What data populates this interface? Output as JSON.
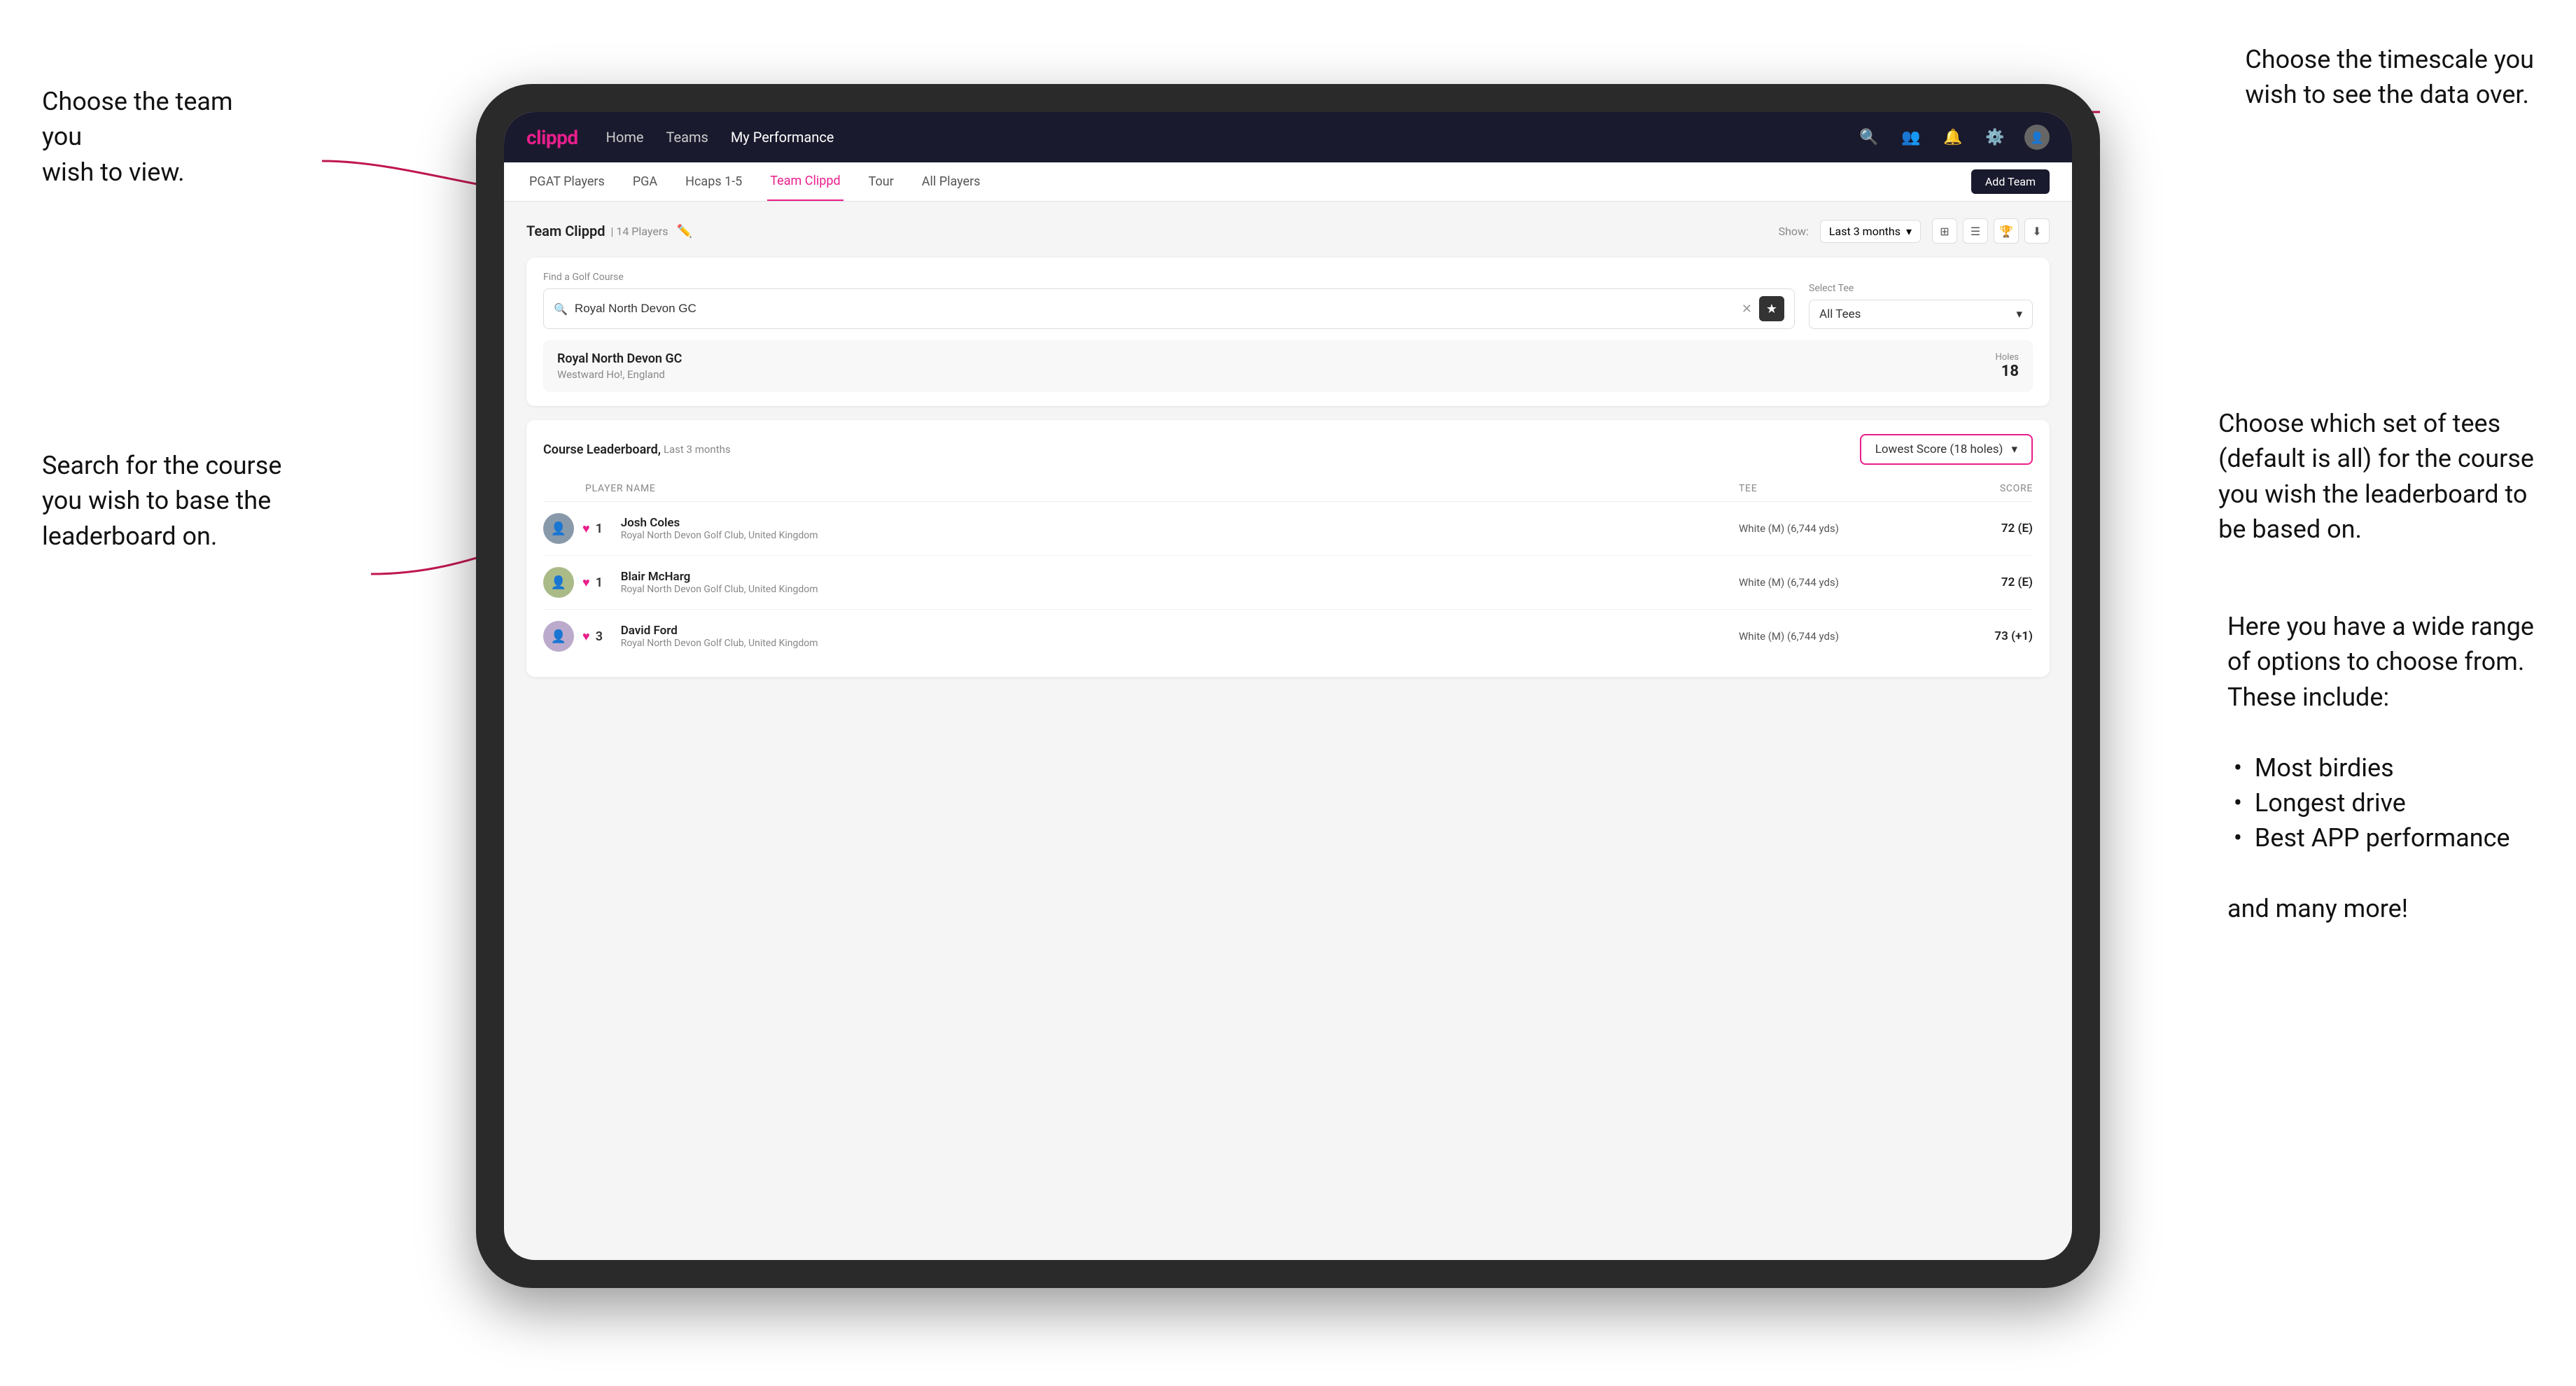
{
  "annotations": {
    "top_left": {
      "line1": "Choose the team you",
      "line2": "wish to view."
    },
    "middle_left": {
      "line1": "Search for the course",
      "line2": "you wish to base the",
      "line3": "leaderboard on."
    },
    "top_right": {
      "line1": "Choose the timescale you",
      "line2": "wish to see the data over."
    },
    "middle_right": {
      "line1": "Choose which set of tees",
      "line2": "(default is all) for the course",
      "line3": "you wish the leaderboard to",
      "line4": "be based on."
    },
    "bottom_right": {
      "intro": "Here you have a wide range",
      "intro2": "of options to choose from.",
      "intro3": "These include:",
      "bullets": [
        "Most birdies",
        "Longest drive",
        "Best APP performance"
      ],
      "outro": "and many more!"
    }
  },
  "nav": {
    "logo": "clippd",
    "links": [
      "Home",
      "Teams",
      "My Performance"
    ],
    "active_link": "My Performance"
  },
  "sub_nav": {
    "items": [
      "PGAT Players",
      "PGA",
      "Hcaps 1-5",
      "Team Clippd",
      "Tour",
      "All Players"
    ],
    "active_item": "Team Clippd",
    "add_team_label": "Add Team"
  },
  "team_header": {
    "name": "Team Clippd",
    "count": "14 Players",
    "show_label": "Show:",
    "show_value": "Last 3 months"
  },
  "search": {
    "find_label": "Find a Golf Course",
    "find_placeholder": "Royal North Devon GC",
    "tee_label": "Select Tee",
    "tee_value": "All Tees"
  },
  "course_result": {
    "name": "Royal North Devon GC",
    "location": "Westward Ho!, England",
    "holes_label": "Holes",
    "holes_value": "18"
  },
  "leaderboard": {
    "title": "Course Leaderboard,",
    "subtitle": "Last 3 months",
    "score_option": "Lowest Score (18 holes)",
    "columns": {
      "player": "PLAYER NAME",
      "tee": "TEE",
      "score": "SCORE"
    },
    "rows": [
      {
        "rank": "1",
        "name": "Josh Coles",
        "club": "Royal North Devon Golf Club, United Kingdom",
        "tee": "White (M) (6,744 yds)",
        "score": "72 (E)"
      },
      {
        "rank": "1",
        "name": "Blair McHarg",
        "club": "Royal North Devon Golf Club, United Kingdom",
        "tee": "White (M) (6,744 yds)",
        "score": "72 (E)"
      },
      {
        "rank": "3",
        "name": "David Ford",
        "club": "Royal North Devon Golf Club, United Kingdom",
        "tee": "White (M) (6,744 yds)",
        "score": "73 (+1)"
      }
    ]
  },
  "colors": {
    "brand_pink": "#e91e8c",
    "nav_dark": "#1a1a2e",
    "accent": "#e91e8c"
  }
}
